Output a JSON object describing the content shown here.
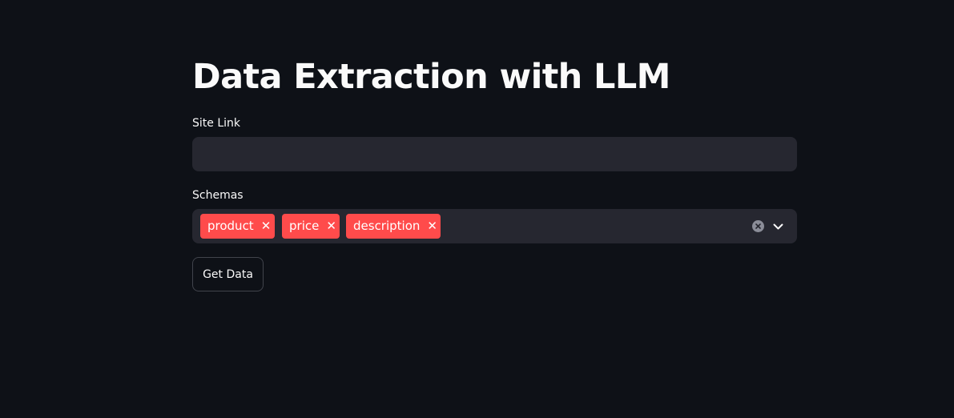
{
  "page": {
    "title": "Data Extraction with LLM"
  },
  "site_link": {
    "label": "Site Link",
    "value": "",
    "placeholder": ""
  },
  "schemas": {
    "label": "Schemas",
    "selected": [
      "product",
      "price",
      "description"
    ],
    "remove_icon": "close-icon",
    "clear_icon": "clear-all-icon",
    "dropdown_icon": "chevron-down-icon"
  },
  "actions": {
    "get_data_label": "Get Data"
  },
  "colors": {
    "background": "#0e1117",
    "input_background": "#262730",
    "accent": "#ff4b4b",
    "text": "#fafafa",
    "button_border": "#41444c"
  }
}
